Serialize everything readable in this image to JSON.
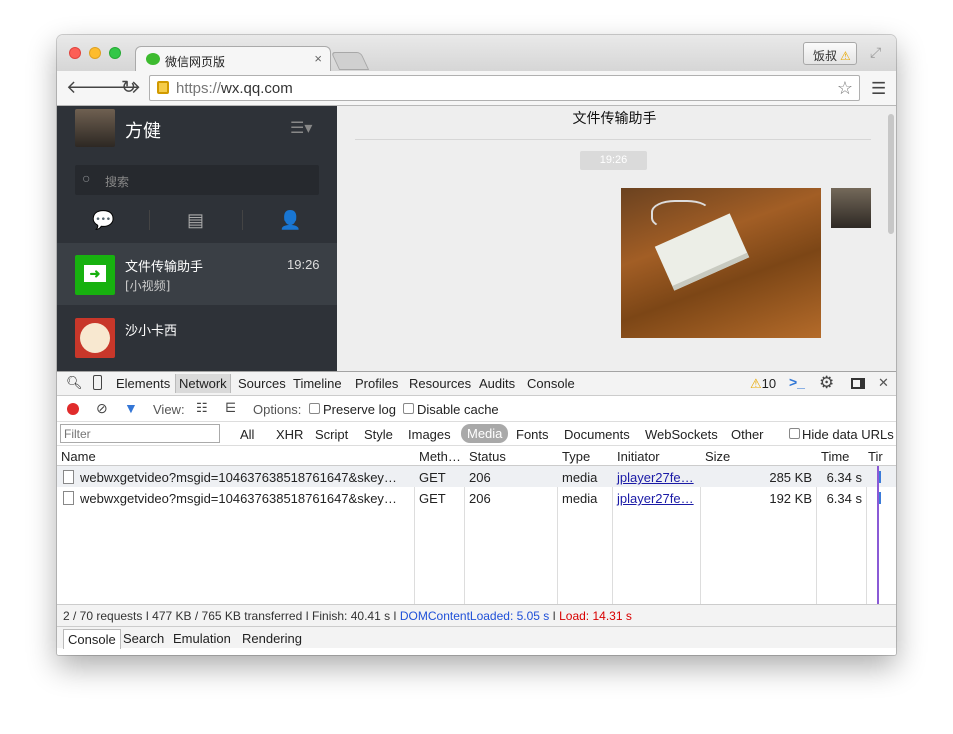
{
  "browser": {
    "tab_title": "微信网页版",
    "tab_close": "×",
    "user_button": "饭叔",
    "user_warning": "⚠",
    "url_scheme": "https://",
    "url_host": "wx.qq.com"
  },
  "wechat": {
    "user_name": "方健",
    "search_placeholder": "搜索",
    "chats": [
      {
        "name": "文件传输助手",
        "time": "19:26",
        "preview": "[小视频]"
      },
      {
        "name": "沙小卡西"
      }
    ],
    "chat_title": "文件传输助手",
    "time_pill": "19:26"
  },
  "devtools": {
    "tabs": [
      "Elements",
      "Network",
      "Sources",
      "Timeline",
      "Profiles",
      "Resources",
      "Audits",
      "Console"
    ],
    "warning_count": "10",
    "view_label": "View:",
    "options_label": "Options:",
    "preserve_log": "Preserve log",
    "disable_cache": "Disable cache",
    "filter_placeholder": "Filter",
    "filter_types": [
      "All",
      "XHR",
      "Script",
      "Style",
      "Images",
      "Media",
      "Fonts",
      "Documents",
      "WebSockets",
      "Other"
    ],
    "hide_data_urls": "Hide data URLs",
    "columns": [
      "Name",
      "Meth…",
      "Status",
      "Type",
      "Initiator",
      "Size",
      "Time",
      "Tir"
    ],
    "rows": [
      {
        "name": "webwxgetvideo?msgid=104637638518761647&skey…",
        "method": "GET",
        "status": "206",
        "type": "media",
        "initiator": "jplayer27fe…",
        "size": "285 KB",
        "time": "6.34 s"
      },
      {
        "name": "webwxgetvideo?msgid=104637638518761647&skey…",
        "method": "GET",
        "status": "206",
        "type": "media",
        "initiator": "jplayer27fe…",
        "size": "192 KB",
        "time": "6.34 s"
      }
    ],
    "status_bar": {
      "summary": "2 / 70 requests  ǀ  477 KB / 765 KB transferred  ǀ  Finish: 40.41 s  ǀ ",
      "dom": "DOMContentLoaded: 5.05 s",
      "sep": " ǀ ",
      "load": "Load: 14.31 s"
    },
    "drawer_tabs": [
      "Console",
      "Search",
      "Emulation",
      "Rendering"
    ]
  },
  "colors": {
    "accent_green": "#17b10f",
    "record_red": "#e02b2b",
    "dom_blue": "#1f50d8",
    "load_red": "#d80000"
  }
}
